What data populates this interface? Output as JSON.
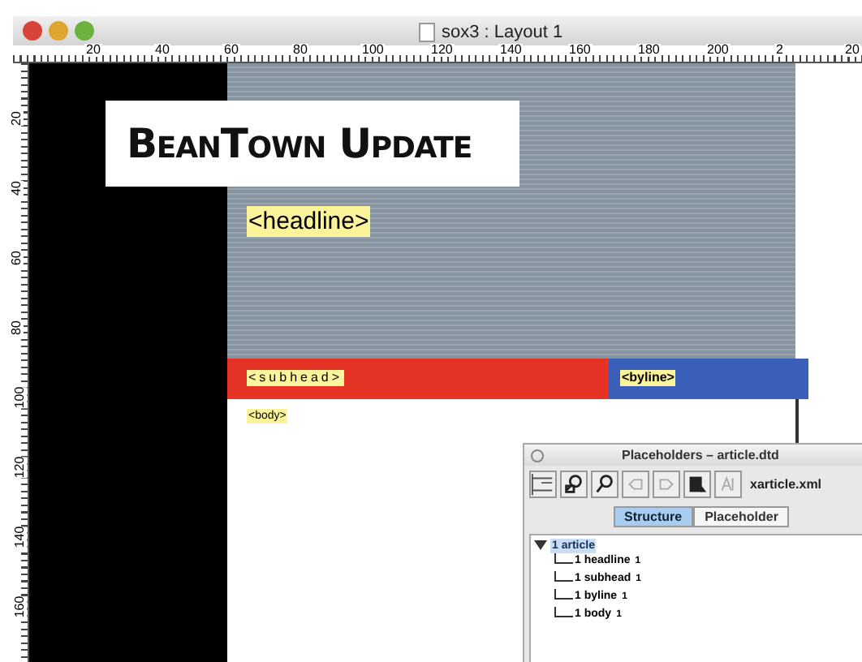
{
  "window": {
    "title": "sox3 : Layout 1",
    "controls": [
      {
        "color": "#d8443a"
      },
      {
        "color": "#e0a531"
      },
      {
        "color": "#6bb23f"
      }
    ]
  },
  "ruler": {
    "horizontal": [
      "20",
      "40",
      "60",
      "80",
      "100",
      "120",
      "140",
      "160",
      "180",
      "200",
      "2",
      "20"
    ],
    "vertical": [
      "20",
      "40",
      "60",
      "80",
      "100",
      "120",
      "140",
      "160"
    ]
  },
  "layout": {
    "masthead": "BeanTown Update",
    "fields": [
      {
        "kind": "headline",
        "label": "<headline>"
      },
      {
        "kind": "subhead",
        "label": "<subhead>"
      },
      {
        "kind": "byline",
        "label": "<byline>"
      },
      {
        "kind": "body",
        "label": "<body>"
      }
    ]
  },
  "palette": {
    "title": "Placeholders – article.dtd",
    "tools": [
      {
        "kind": "tree"
      },
      {
        "kind": "find"
      },
      {
        "kind": "replace"
      },
      {
        "kind": "prev"
      },
      {
        "kind": "next"
      },
      {
        "kind": "insert"
      },
      {
        "kind": "text"
      }
    ],
    "file": "xarticle.xml",
    "tabs": [
      {
        "label": "Structure",
        "selected": true
      },
      {
        "label": "Placeholder",
        "selected": false
      }
    ],
    "tree": {
      "label": "1 article",
      "expanded": true,
      "selected": true,
      "children": [
        {
          "label": "1 headline",
          "mark": "1"
        },
        {
          "label": "1 subhead",
          "mark": "1"
        },
        {
          "label": "1 byline",
          "mark": "1"
        },
        {
          "label": "1 body",
          "mark": "1"
        }
      ]
    }
  }
}
